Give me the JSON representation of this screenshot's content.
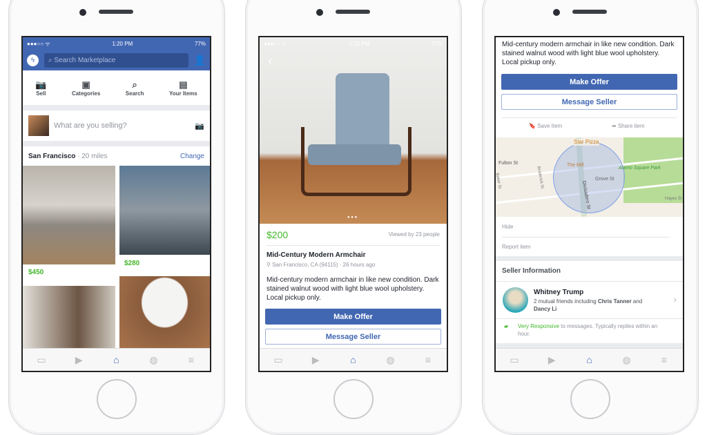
{
  "status": {
    "time": "1:20 PM",
    "battery": "77%"
  },
  "feed": {
    "search_placeholder": "Search Marketplace",
    "actions": [
      {
        "label": "Sell",
        "icon": "camera-icon"
      },
      {
        "label": "Categories",
        "icon": "categories-icon"
      },
      {
        "label": "Search",
        "icon": "search-icon"
      },
      {
        "label": "Your Items",
        "icon": "box-icon"
      }
    ],
    "composer_placeholder": "What are you selling?",
    "location": "San Francisco",
    "distance": "· 20 miles",
    "change": "Change",
    "listings": [
      {
        "price": "$450"
      },
      {
        "price": "$280"
      }
    ]
  },
  "detail": {
    "price": "$200",
    "views": "Viewed by 23 people",
    "title": "Mid-Century Modern Armchair",
    "location": "San Francisco, CA (94115) · 26 hours ago",
    "description": "Mid-century modern armchair in like new condition. Dark stained walnut wood with light blue wool upholstery. Local pickup only.",
    "make_offer": "Make Offer",
    "message_seller": "Message Seller",
    "save": "Save Item",
    "share": "Share item",
    "map_labels": {
      "fulton": "Fulton St",
      "grove": "Grove St",
      "divisadero": "Divisadero St",
      "broderick": "Broderick St",
      "park": "Alamo Square Park",
      "mill": "The Mill",
      "pizza": "Star Pizza",
      "hayes": "Hayes St",
      "baker": "Baker St"
    },
    "hide": "Hide",
    "report": "Report item",
    "seller_header": "Seller Information",
    "seller": {
      "name": "Whitney Trump",
      "mutual_prefix": "2 mutual friends including ",
      "friend1": "Chris Tanner",
      "and": " and ",
      "friend2": "Dancy Li"
    },
    "responsive": "Very Responsive",
    "responsive_rest": " to messages. Typically replies within an hour."
  },
  "colors": {
    "brand": "#4267b2",
    "price": "#42b72a"
  }
}
